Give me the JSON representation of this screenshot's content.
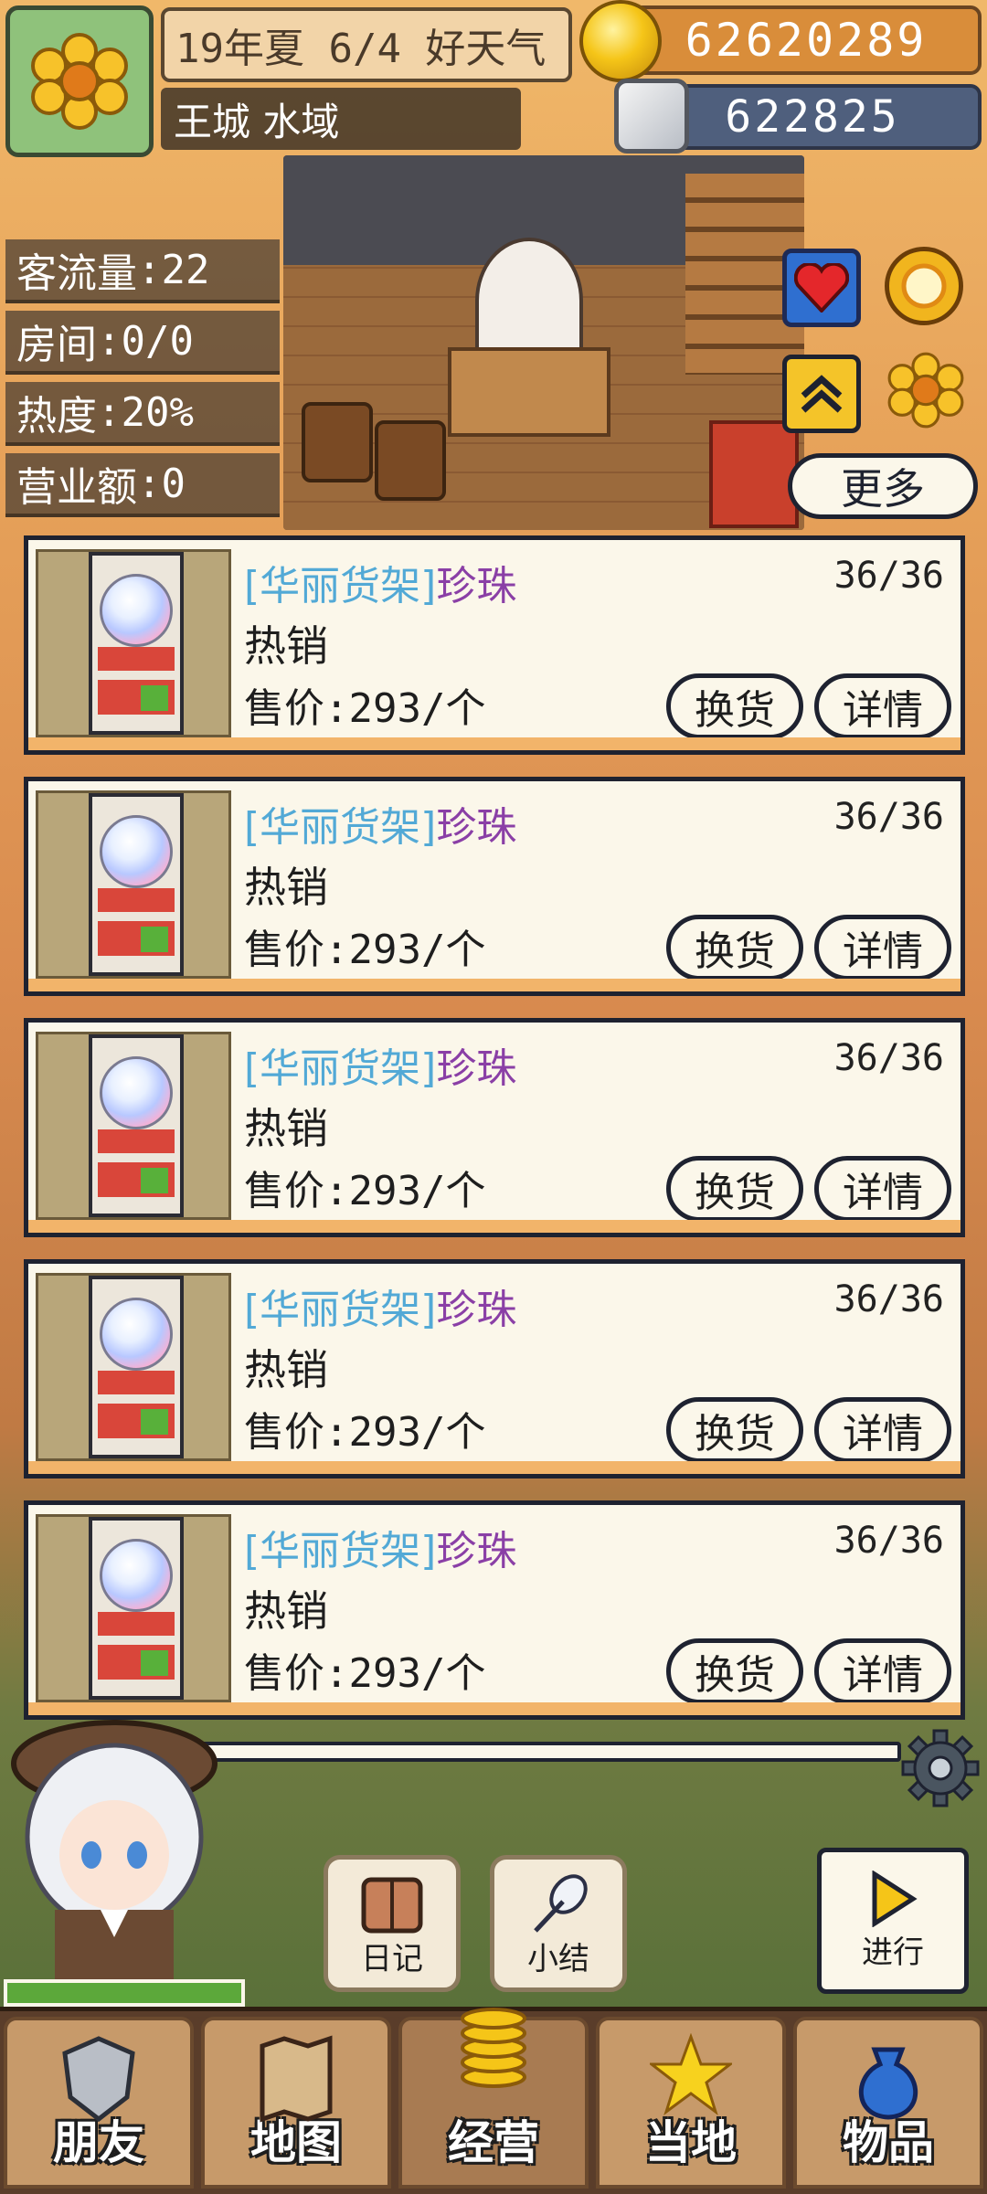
{
  "header": {
    "date_text": "19年夏 6/4 好天气",
    "location": "王城 水域",
    "gold": "62620289",
    "silver": "622825",
    "icon": "flower-icon"
  },
  "stats": [
    {
      "label": "客流量",
      "value": ":22"
    },
    {
      "label": "房间",
      "value": ":0/0"
    },
    {
      "label": "热度",
      "value": ":20%"
    },
    {
      "label": "营业额",
      "value": ":0"
    }
  ],
  "side_icons": [
    "heart-icon",
    "sun-icon",
    "chevron-up-icon",
    "flower-icon"
  ],
  "more_label": "更多",
  "items": [
    {
      "tag": "[华丽货架]",
      "name": "珍珠",
      "count": "36/36",
      "status": "热销",
      "price": "售价:293/个",
      "swap_label": "换货",
      "detail_label": "详情"
    },
    {
      "tag": "[华丽货架]",
      "name": "珍珠",
      "count": "36/36",
      "status": "热销",
      "price": "售价:293/个",
      "swap_label": "换货",
      "detail_label": "详情"
    },
    {
      "tag": "[华丽货架]",
      "name": "珍珠",
      "count": "36/36",
      "status": "热销",
      "price": "售价:293/个",
      "swap_label": "换货",
      "detail_label": "详情"
    },
    {
      "tag": "[华丽货架]",
      "name": "珍珠",
      "count": "36/36",
      "status": "热销",
      "price": "售价:293/个",
      "swap_label": "换货",
      "detail_label": "详情"
    },
    {
      "tag": "[华丽货架]",
      "name": "珍珠",
      "count": "36/36",
      "status": "热销",
      "price": "售价:293/个",
      "swap_label": "换货",
      "detail_label": "详情"
    }
  ],
  "actions": {
    "diary": "日记",
    "summary": "小结",
    "go": "进行"
  },
  "hp_fraction": 1.0,
  "nav": [
    {
      "label": "朋友",
      "icon": "shield-icon"
    },
    {
      "label": "地图",
      "icon": "map-icon"
    },
    {
      "label": "经营",
      "icon": "coins-icon"
    },
    {
      "label": "当地",
      "icon": "star-icon"
    },
    {
      "label": "物品",
      "icon": "bag-icon"
    }
  ],
  "colors": {
    "card_border": "#1e2230",
    "tag_blue": "#52a9d6",
    "name_purple": "#8a3fa6",
    "gold_bar": "#d98d3a",
    "silver_bar": "#4f5f7d"
  }
}
